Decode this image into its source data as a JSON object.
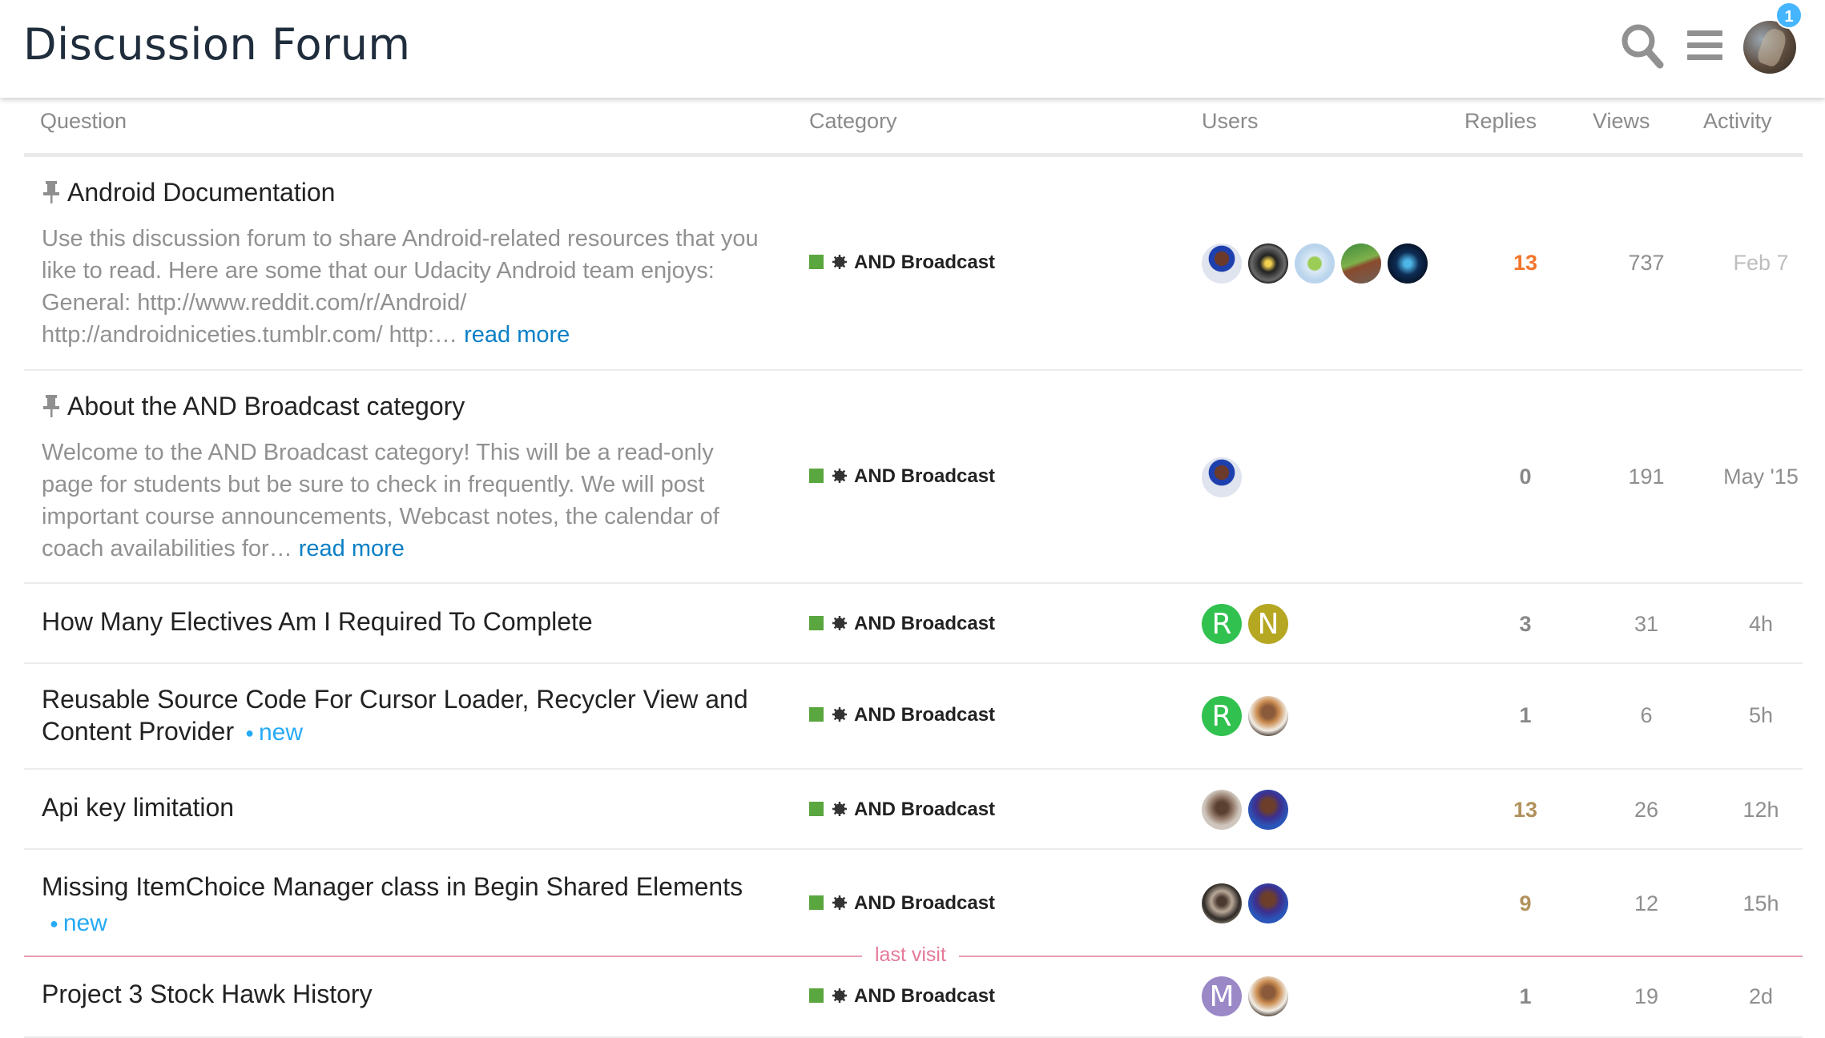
{
  "header": {
    "title": "Discussion Forum",
    "notification_count": "1"
  },
  "columns": {
    "question": "Question",
    "category": "Category",
    "users": "Users",
    "replies": "Replies",
    "views": "Views",
    "activity": "Activity"
  },
  "category_name": "AND Broadcast",
  "category_color": "#5aa63f",
  "topics": [
    {
      "title": "Android Documentation",
      "pinned": true,
      "excerpt": "Use this discussion forum to share Android-related resources that you like to read. Here are some that our Udacity Android team enjoys: General: http://www.reddit.com/r/Android/ http://androidniceties.tumblr.com/ http:…",
      "read_more": "read more",
      "replies": "13",
      "views": "737",
      "activity": "Feb 7"
    },
    {
      "title": "About the AND Broadcast category",
      "pinned": true,
      "excerpt": "Welcome to the AND Broadcast category! This will be a read-only page for students but be sure to check in frequently. We will post important course announcements, Webcast notes, the calendar of coach availabilities for…",
      "read_more": "read more",
      "replies": "0",
      "views": "191",
      "activity": "May '15"
    },
    {
      "title": "How Many Electives Am I Required To Complete",
      "avatar_letters": [
        "R",
        "N"
      ],
      "replies": "3",
      "views": "31",
      "activity": "4h"
    },
    {
      "title": "Reusable Source Code For Cursor Loader, Recycler View and Content Provider",
      "new_label": "new",
      "avatar_letters": [
        "R"
      ],
      "replies": "1",
      "views": "6",
      "activity": "5h"
    },
    {
      "title": "Api key limitation",
      "replies": "13",
      "views": "26",
      "activity": "12h"
    },
    {
      "title": "Missing ItemChoice Manager class in Begin Shared Elements",
      "new_label": "new",
      "replies": "9",
      "views": "12",
      "activity": "15h"
    },
    {
      "title": "Project 3 Stock Hawk History",
      "avatar_letters": [
        "M"
      ],
      "replies": "1",
      "views": "19",
      "activity": "2d"
    }
  ],
  "last_visit_label": "last visit"
}
